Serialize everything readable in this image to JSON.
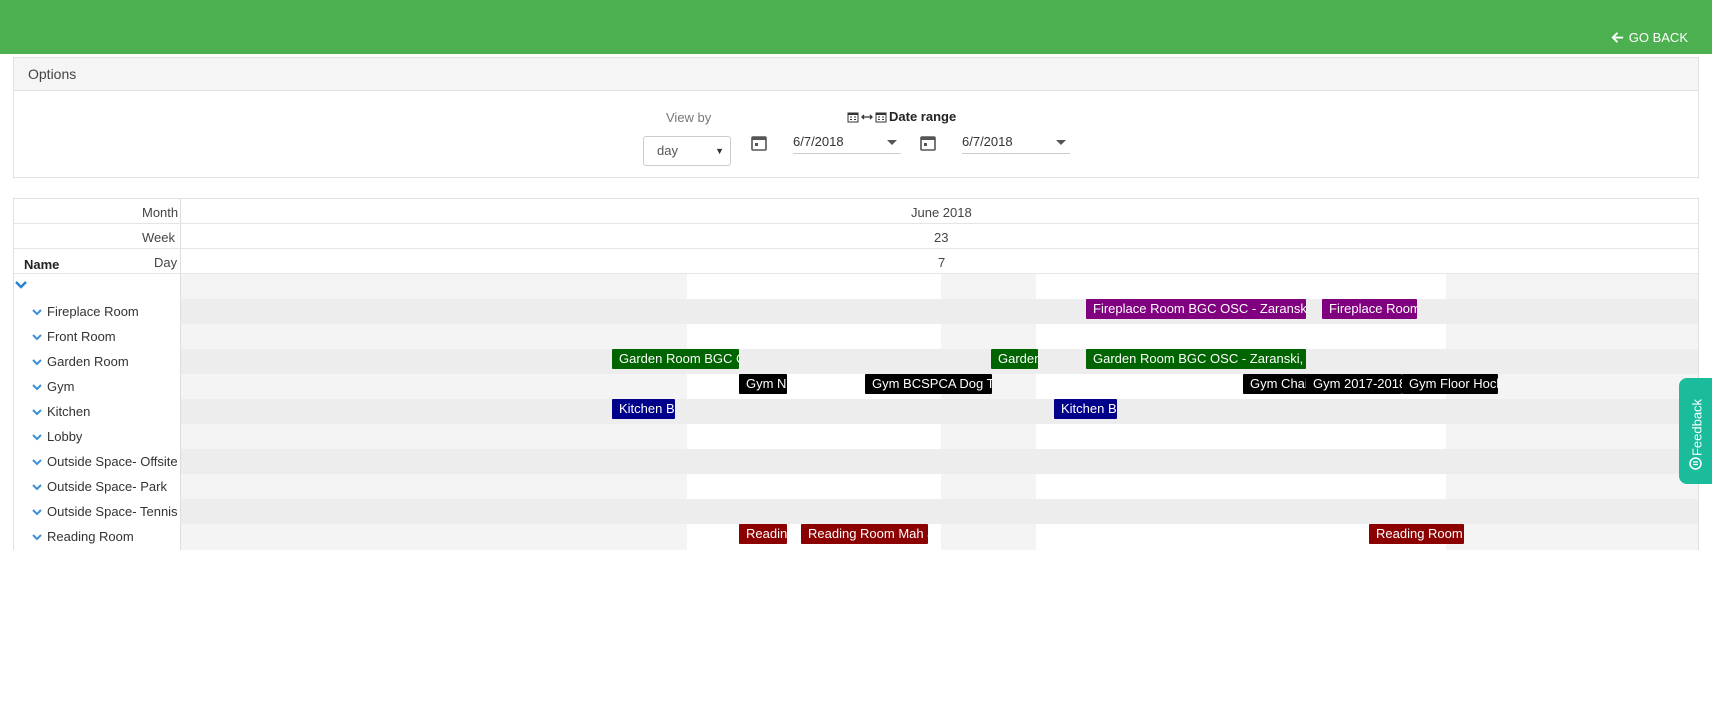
{
  "header": {
    "go_back_label": "GO BACK",
    "color": "#4caf50"
  },
  "options": {
    "title": "Options",
    "view_by_label": "View by",
    "view_by_value": "day",
    "date_range_label": "Date range",
    "start_date": "6/7/2018",
    "end_date": "6/7/2018"
  },
  "scheduler": {
    "month_label": "Month",
    "week_label": "Week",
    "day_label": "Day",
    "name_label": "Name",
    "month_value": "June 2018",
    "week_value": "23",
    "day_value": "7",
    "resources": [
      "Fireplace Room",
      "Front Room",
      "Garden Room",
      "Gym",
      "Kitchen",
      "Lobby",
      "Outside Space- Offsite",
      "Outside Space- Park",
      "Outside Space- Tennis C",
      "Reading Room"
    ],
    "events": [
      {
        "resource": 0,
        "text": "Fireplace Room BGC OSC - Zaranski,",
        "color": "#800080"
      },
      {
        "resource": 0,
        "text": "Fireplace Room",
        "color": "#800080"
      },
      {
        "resource": 2,
        "text": "Garden Room BGC C",
        "color": "#006400"
      },
      {
        "resource": 2,
        "text": "Garden",
        "color": "#006400"
      },
      {
        "resource": 2,
        "text": "Garden Room BGC OSC - Zaranski, T",
        "color": "#006400"
      },
      {
        "resource": 3,
        "text": "Gym N",
        "color": "#000000"
      },
      {
        "resource": 3,
        "text": "Gym BCSPCA Dog T",
        "color": "#000000"
      },
      {
        "resource": 3,
        "text": "Gym Chai",
        "color": "#000000"
      },
      {
        "resource": 3,
        "text": "Gym 2017-2018",
        "color": "#000000"
      },
      {
        "resource": 3,
        "text": "Gym Floor Hock",
        "color": "#000000"
      },
      {
        "resource": 4,
        "text": "Kitchen B",
        "color": "#00008b"
      },
      {
        "resource": 4,
        "text": "Kitchen B",
        "color": "#00008b"
      },
      {
        "resource": 9,
        "text": "Readin",
        "color": "#8b0000"
      },
      {
        "resource": 9,
        "text": "Reading Room Mah J",
        "color": "#8b0000"
      },
      {
        "resource": 9,
        "text": "Reading Room",
        "color": "#8b0000"
      }
    ]
  },
  "feedback": {
    "label": "Feedback",
    "color": "#1abc9c"
  }
}
